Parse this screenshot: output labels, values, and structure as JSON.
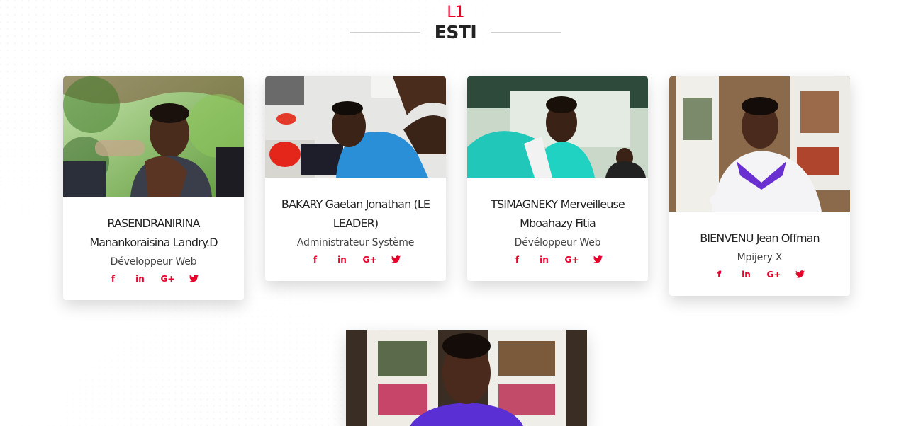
{
  "section": {
    "subtitle": "L1",
    "title": "ESTI"
  },
  "social_icons": [
    "facebook-icon",
    "linkedin-icon",
    "google-plus-icon",
    "twitter-icon"
  ],
  "colors": {
    "accent": "#e8002a",
    "title": "#232323",
    "divider": "#cfcfcf"
  },
  "members": [
    {
      "name": "RASENDRANIRINA Manankoraisina Landry.D",
      "role": "Développeur Web",
      "photo_alt": "Photo de RASENDRANIRINA"
    },
    {
      "name": "BAKARY Gaetan Jonathan (LE LEADER)",
      "role": "Administrateur Système",
      "photo_alt": "Photo de BAKARY"
    },
    {
      "name": "TSIMAGNEKY Merveilleuse Mboahazy Fitia",
      "role": "Dévéloppeur Web",
      "photo_alt": "Photo de TSIMAGNEKY"
    },
    {
      "name": "BIENVENU Jean Offman",
      "role": "Mpijery X",
      "photo_alt": "Photo de BIENVENU"
    },
    {
      "photo_alt": "Photo du cinquième membre"
    }
  ]
}
